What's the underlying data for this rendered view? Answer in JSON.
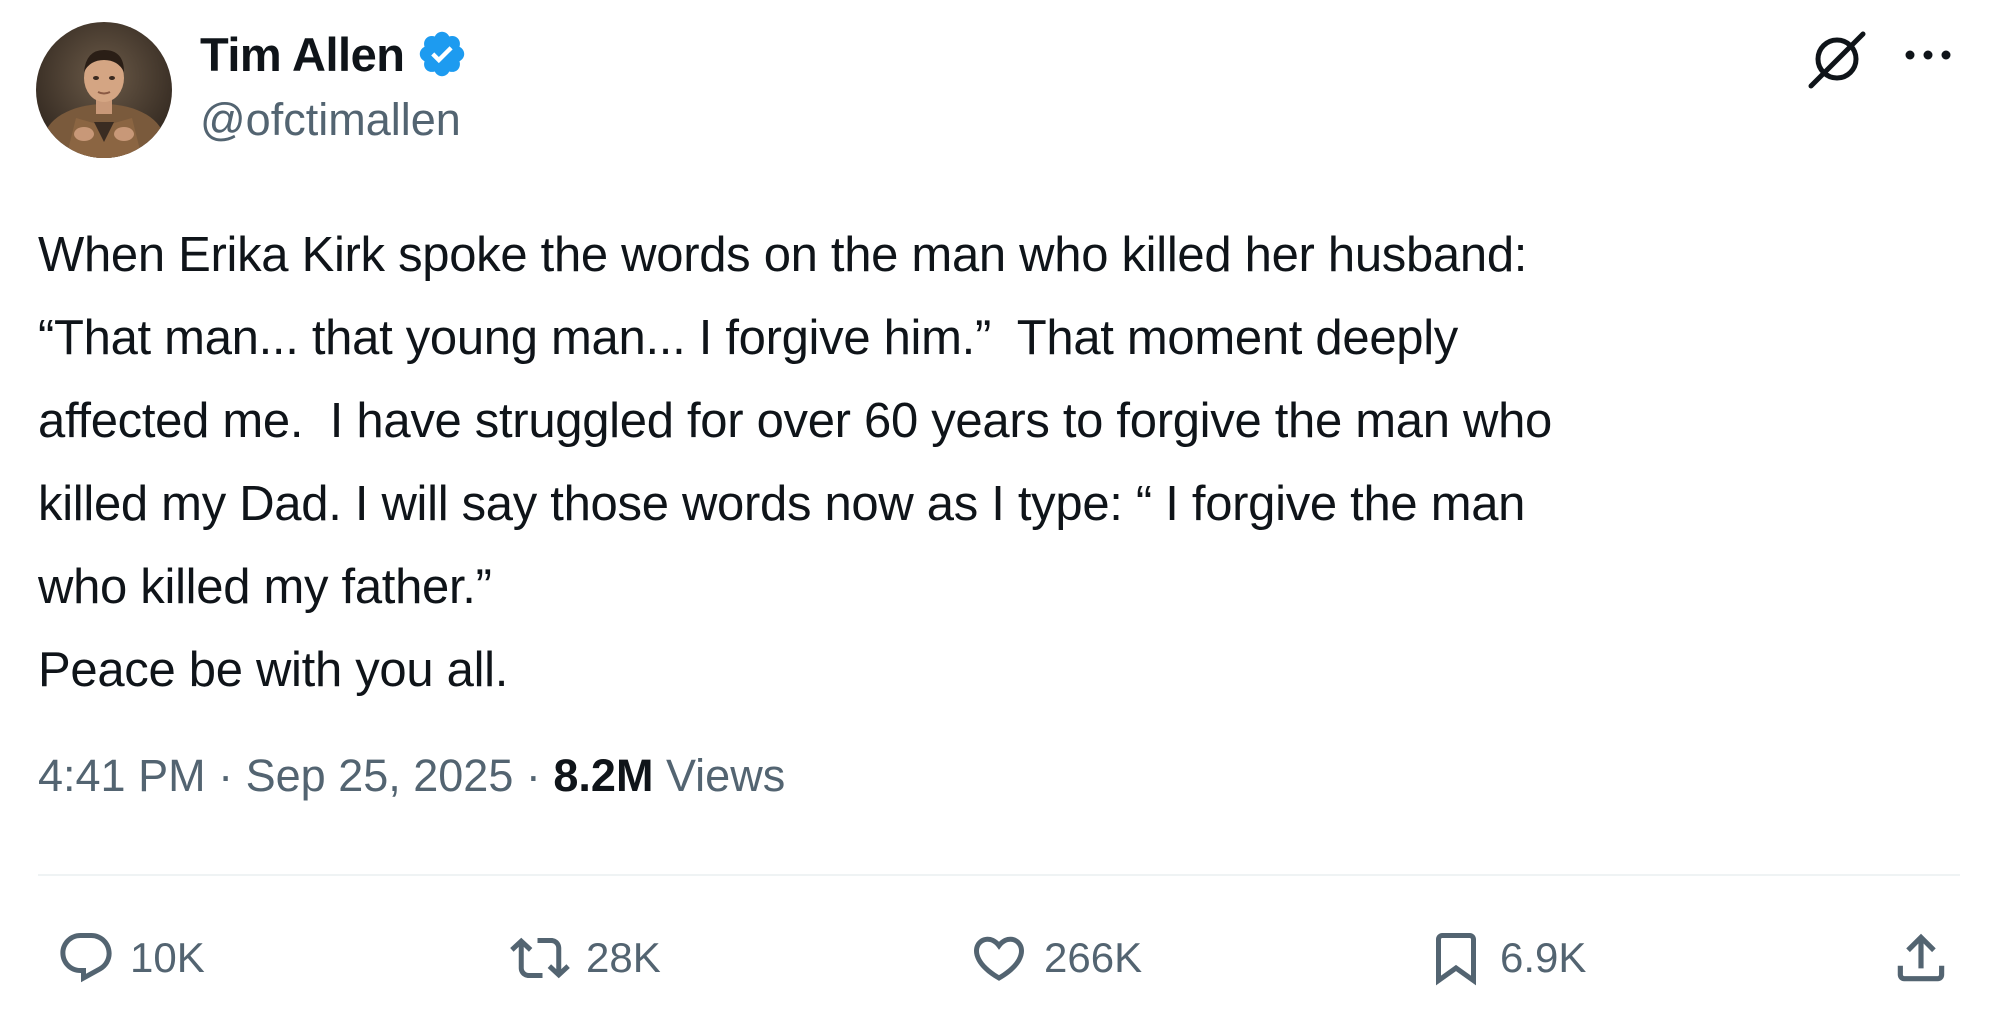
{
  "author": {
    "display_name": "Tim Allen",
    "handle": "@ofctimallen",
    "verified": true,
    "verified_color": "#1d9bf0"
  },
  "header_icons": [
    "grok-icon",
    "more-icon"
  ],
  "tweet": {
    "text": "When Erika Kirk spoke the words on the man who killed her husband:\n“That man... that young man... I forgive him.”  That moment deeply\naffected me.  I have struggled for over 60 years to forgive the man who\nkilled my Dad. I will say those words now as I type: “ I forgive the man\nwho killed my father.”\nPeace be with you all."
  },
  "meta": {
    "time": "4:41 PM",
    "separator": "·",
    "date": "Sep 25, 2025",
    "views_count": "8.2M",
    "views_label": "Views"
  },
  "actions": {
    "reply": {
      "icon": "reply-icon",
      "count": "10K"
    },
    "repost": {
      "icon": "repost-icon",
      "count": "28K"
    },
    "like": {
      "icon": "heart-icon",
      "count": "266K"
    },
    "bookmark": {
      "icon": "bookmark-icon",
      "count": "6.9K"
    },
    "share": {
      "icon": "share-icon"
    }
  },
  "colors": {
    "text_primary": "#0f1419",
    "text_secondary": "#536471",
    "divider": "#eff3f4",
    "accent": "#1d9bf0"
  }
}
